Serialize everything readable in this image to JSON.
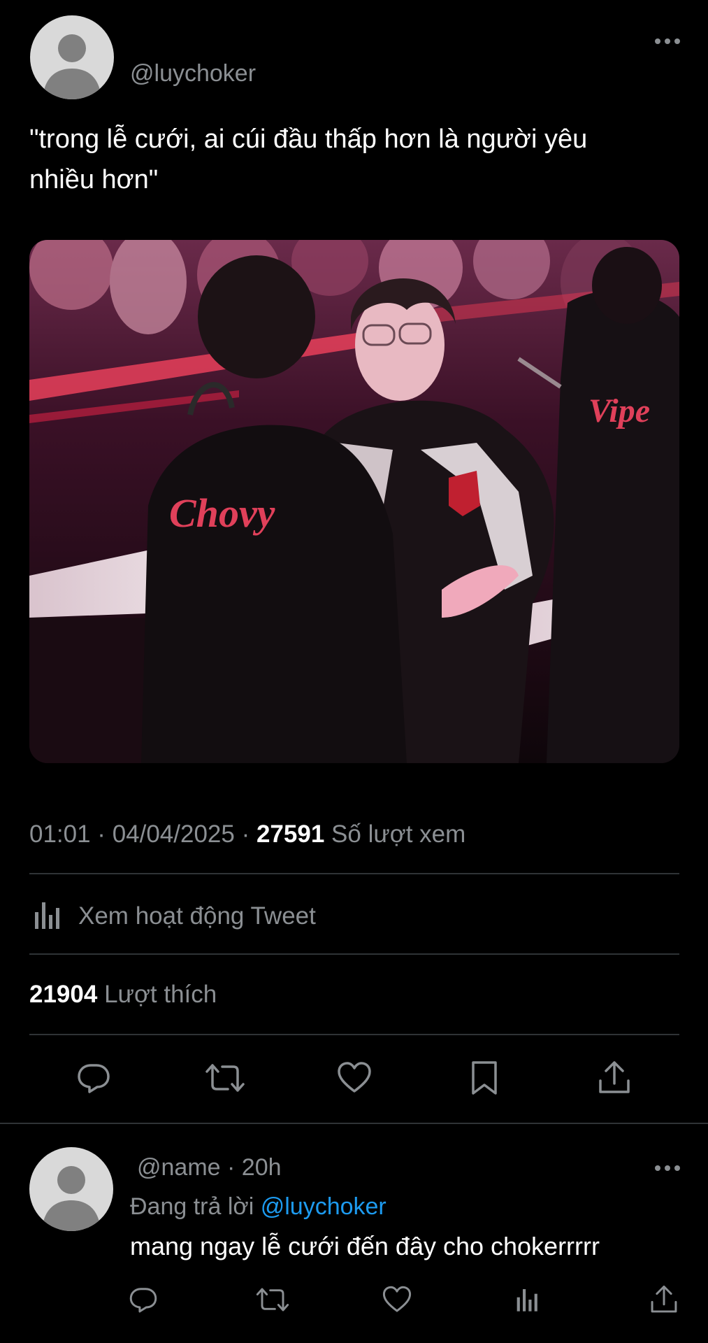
{
  "tweet": {
    "handle": "@luychoker",
    "text_line1": "\"trong lễ cưới, ai cúi đầu thấp hơn là người yêu",
    "text_line2": "nhiều hơn\"",
    "image": {
      "jersey_front": "Chovy",
      "jersey_right": "Vipe"
    },
    "meta": {
      "time_date": "01:01 · 04/04/2025 · ",
      "views": "27591",
      "views_label": "Số lượt xem"
    },
    "activity_label": "Xem hoạt động Tweet",
    "likes": {
      "count": "21904",
      "label": "Lượt thích"
    },
    "actions": [
      "reply-icon",
      "retweet-icon",
      "like-icon",
      "bookmark-icon",
      "share-icon"
    ]
  },
  "reply": {
    "handle_time": "@name · 20h",
    "replying_prefix": "Đang trả lời",
    "replying_to": "@luychoker",
    "text": "mang ngay lễ cưới đến đây cho chokerrrrr",
    "actions": [
      "reply-icon",
      "retweet-icon",
      "like-icon",
      "analytics-icon",
      "share-icon"
    ]
  },
  "colors": {
    "background": "#000000",
    "text": "#ffffff",
    "muted": "#8b8f93",
    "divider": "#2f3336",
    "link": "#1d9bf0"
  }
}
